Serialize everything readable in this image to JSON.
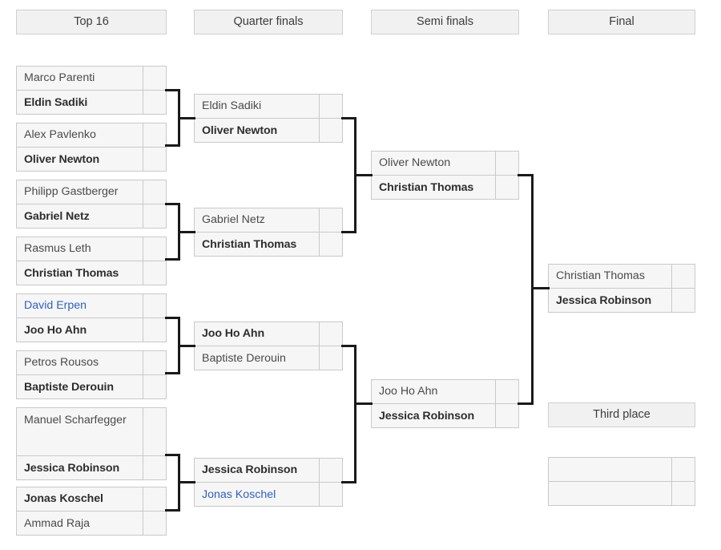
{
  "rounds": [
    {
      "id": "top16",
      "label": "Top 16"
    },
    {
      "id": "quarterfinals",
      "label": "Quarter finals"
    },
    {
      "id": "semifinals",
      "label": "Semi finals"
    },
    {
      "id": "final",
      "label": "Final"
    },
    {
      "id": "thirdplace",
      "label": "Third place"
    }
  ],
  "colors": {
    "box_fill": "#f6f6f6",
    "box_border": "#c9c9c9",
    "header_fill": "#f1f1f1",
    "header_border": "#cfcfcf",
    "text": "#4a4a4a",
    "winner_text": "#2e2e2e",
    "link_text": "#2f5fc4",
    "connector": "#1a1a1a",
    "page_background": "#ffffff"
  },
  "top16": [
    {
      "top": {
        "name": "Marco Parenti",
        "score": "",
        "winner": false,
        "link": false
      },
      "bottom": {
        "name": "Eldin Sadiki",
        "score": "",
        "winner": true,
        "link": false
      }
    },
    {
      "top": {
        "name": "Alex Pavlenko",
        "score": "",
        "winner": false,
        "link": false
      },
      "bottom": {
        "name": "Oliver Newton",
        "score": "",
        "winner": true,
        "link": false
      }
    },
    {
      "top": {
        "name": "Philipp Gastberger",
        "score": "",
        "winner": false,
        "link": false
      },
      "bottom": {
        "name": "Gabriel Netz",
        "score": "",
        "winner": true,
        "link": false
      }
    },
    {
      "top": {
        "name": "Rasmus Leth",
        "score": "",
        "winner": false,
        "link": false
      },
      "bottom": {
        "name": "Christian Thomas",
        "score": "",
        "winner": true,
        "link": false
      }
    },
    {
      "top": {
        "name": "David Erpen",
        "score": "",
        "winner": false,
        "link": true
      },
      "bottom": {
        "name": "Joo Ho Ahn",
        "score": "",
        "winner": true,
        "link": false
      }
    },
    {
      "top": {
        "name": "Petros Rousos",
        "score": "",
        "winner": false,
        "link": false
      },
      "bottom": {
        "name": "Baptiste Derouin",
        "score": "",
        "winner": true,
        "link": false
      }
    },
    {
      "top": {
        "name": "Manuel Scharfegger",
        "score": "",
        "winner": false,
        "link": false
      },
      "bottom": {
        "name": "Jessica Robinson",
        "score": "",
        "winner": true,
        "link": false
      }
    },
    {
      "top": {
        "name": "Jonas Koschel",
        "score": "",
        "winner": true,
        "link": false
      },
      "bottom": {
        "name": "Ammad Raja",
        "score": "",
        "winner": false,
        "link": false
      }
    }
  ],
  "quarterfinals": [
    {
      "top": {
        "name": "Eldin Sadiki",
        "score": "",
        "winner": false,
        "link": false
      },
      "bottom": {
        "name": "Oliver Newton",
        "score": "",
        "winner": true,
        "link": false
      }
    },
    {
      "top": {
        "name": "Gabriel Netz",
        "score": "",
        "winner": false,
        "link": false
      },
      "bottom": {
        "name": "Christian Thomas",
        "score": "",
        "winner": true,
        "link": false
      }
    },
    {
      "top": {
        "name": "Joo Ho Ahn",
        "score": "",
        "winner": true,
        "link": false
      },
      "bottom": {
        "name": "Baptiste Derouin",
        "score": "",
        "winner": false,
        "link": false
      }
    },
    {
      "top": {
        "name": "Jessica Robinson",
        "score": "",
        "winner": true,
        "link": false
      },
      "bottom": {
        "name": "Jonas Koschel",
        "score": "",
        "winner": false,
        "link": true
      }
    }
  ],
  "semifinals": [
    {
      "top": {
        "name": "Oliver Newton",
        "score": "",
        "winner": false,
        "link": false
      },
      "bottom": {
        "name": "Christian Thomas",
        "score": "",
        "winner": true,
        "link": false
      }
    },
    {
      "top": {
        "name": "Joo Ho Ahn",
        "score": "",
        "winner": false,
        "link": false
      },
      "bottom": {
        "name": "Jessica Robinson",
        "score": "",
        "winner": true,
        "link": false
      }
    }
  ],
  "final": [
    {
      "top": {
        "name": "Christian Thomas",
        "score": "",
        "winner": false,
        "link": false
      },
      "bottom": {
        "name": "Jessica Robinson",
        "score": "",
        "winner": true,
        "link": false
      }
    }
  ],
  "thirdplace": [
    {
      "top": {
        "name": "",
        "score": "",
        "winner": false,
        "link": false
      },
      "bottom": {
        "name": "",
        "score": "",
        "winner": false,
        "link": false
      }
    }
  ]
}
